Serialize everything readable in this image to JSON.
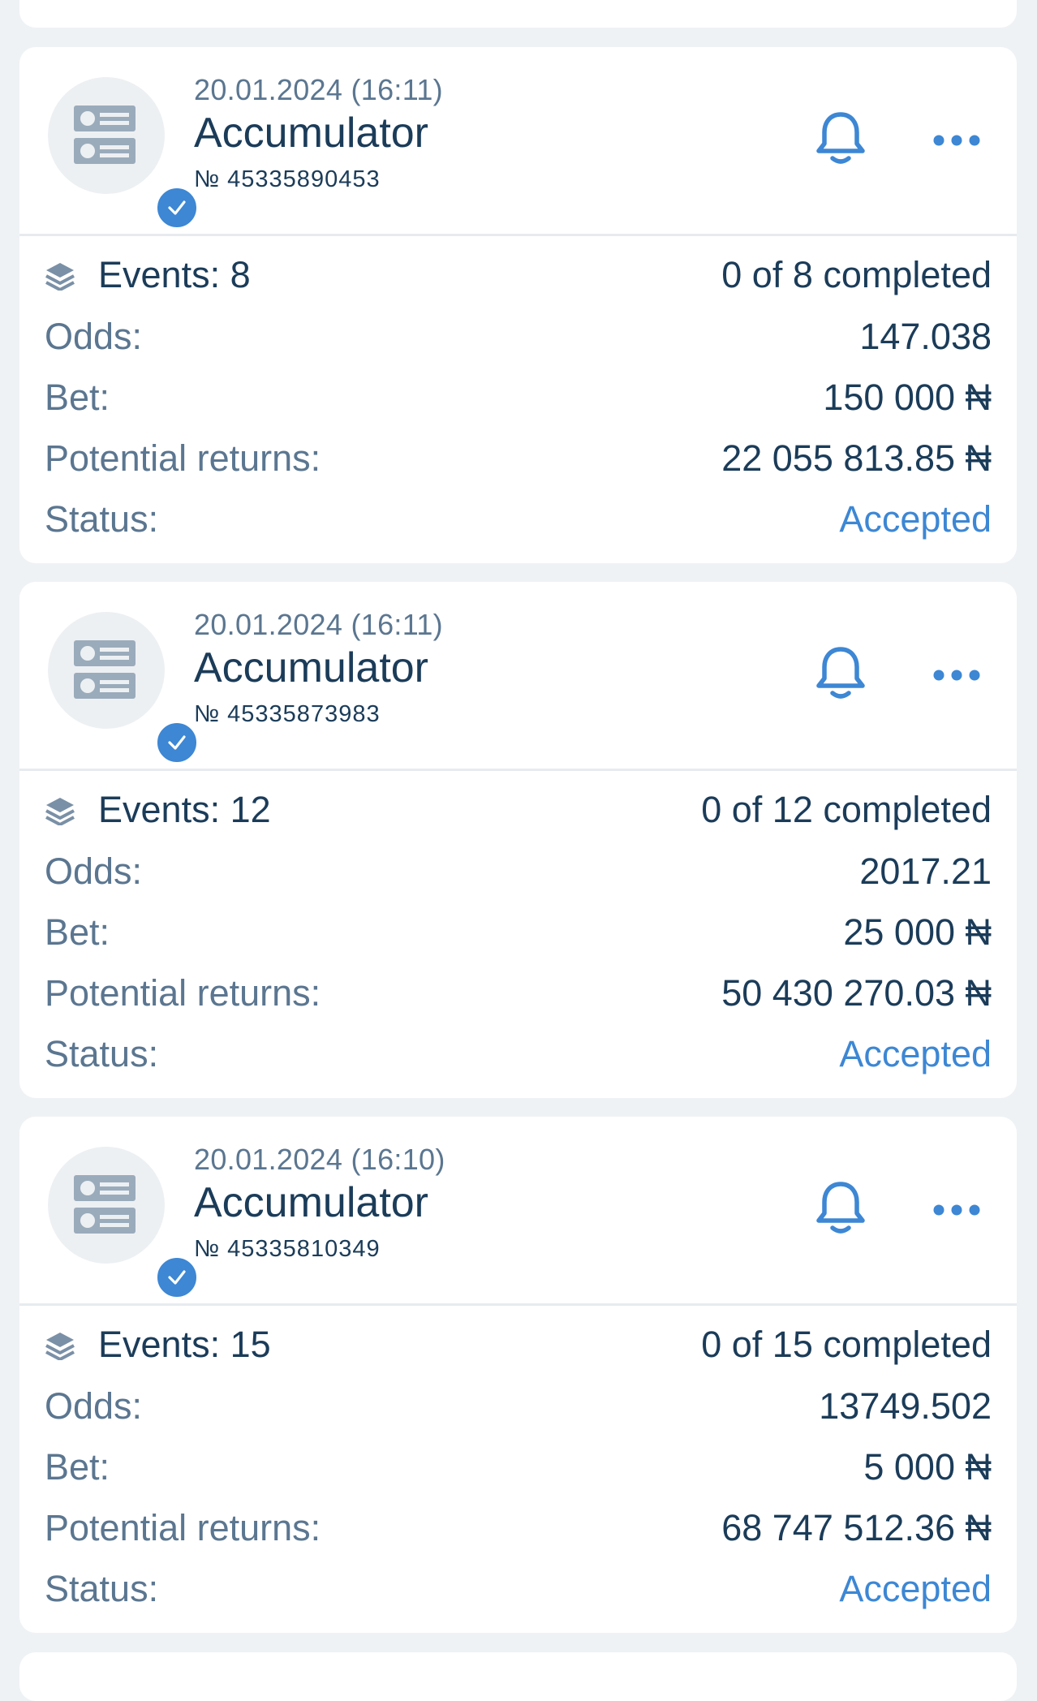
{
  "currency_symbol": "₦",
  "labels": {
    "odds": "Odds:",
    "bet": "Bet:",
    "potential_returns": "Potential returns:",
    "status": "Status:"
  },
  "colors": {
    "accent": "#3d87d4",
    "text_dark": "#1b3c59",
    "text_muted": "#5b7690",
    "background": "#eff2f5"
  },
  "bets": [
    {
      "date": "20.01.2024 (16:11)",
      "type": "Accumulator",
      "number": "№ 45335890453",
      "events": "Events: 8",
      "completed": "0 of 8 completed",
      "odds": "147.038",
      "bet": "150 000 ₦",
      "potential_returns": "22 055 813.85 ₦",
      "status": "Accepted"
    },
    {
      "date": "20.01.2024 (16:11)",
      "type": "Accumulator",
      "number": "№ 45335873983",
      "events": "Events: 12",
      "completed": "0 of 12 completed",
      "odds": "2017.21",
      "bet": "25 000 ₦",
      "potential_returns": "50 430 270.03 ₦",
      "status": "Accepted"
    },
    {
      "date": "20.01.2024 (16:10)",
      "type": "Accumulator",
      "number": "№ 45335810349",
      "events": "Events: 15",
      "completed": "0 of 15 completed",
      "odds": "13749.502",
      "bet": "5 000 ₦",
      "potential_returns": "68 747 512.36 ₦",
      "status": "Accepted"
    }
  ],
  "icons": {
    "avatar": "bet-slip-icon",
    "verified": "checkmark-icon",
    "notify": "bell-icon",
    "menu": "more-icon",
    "events": "layers-icon"
  }
}
